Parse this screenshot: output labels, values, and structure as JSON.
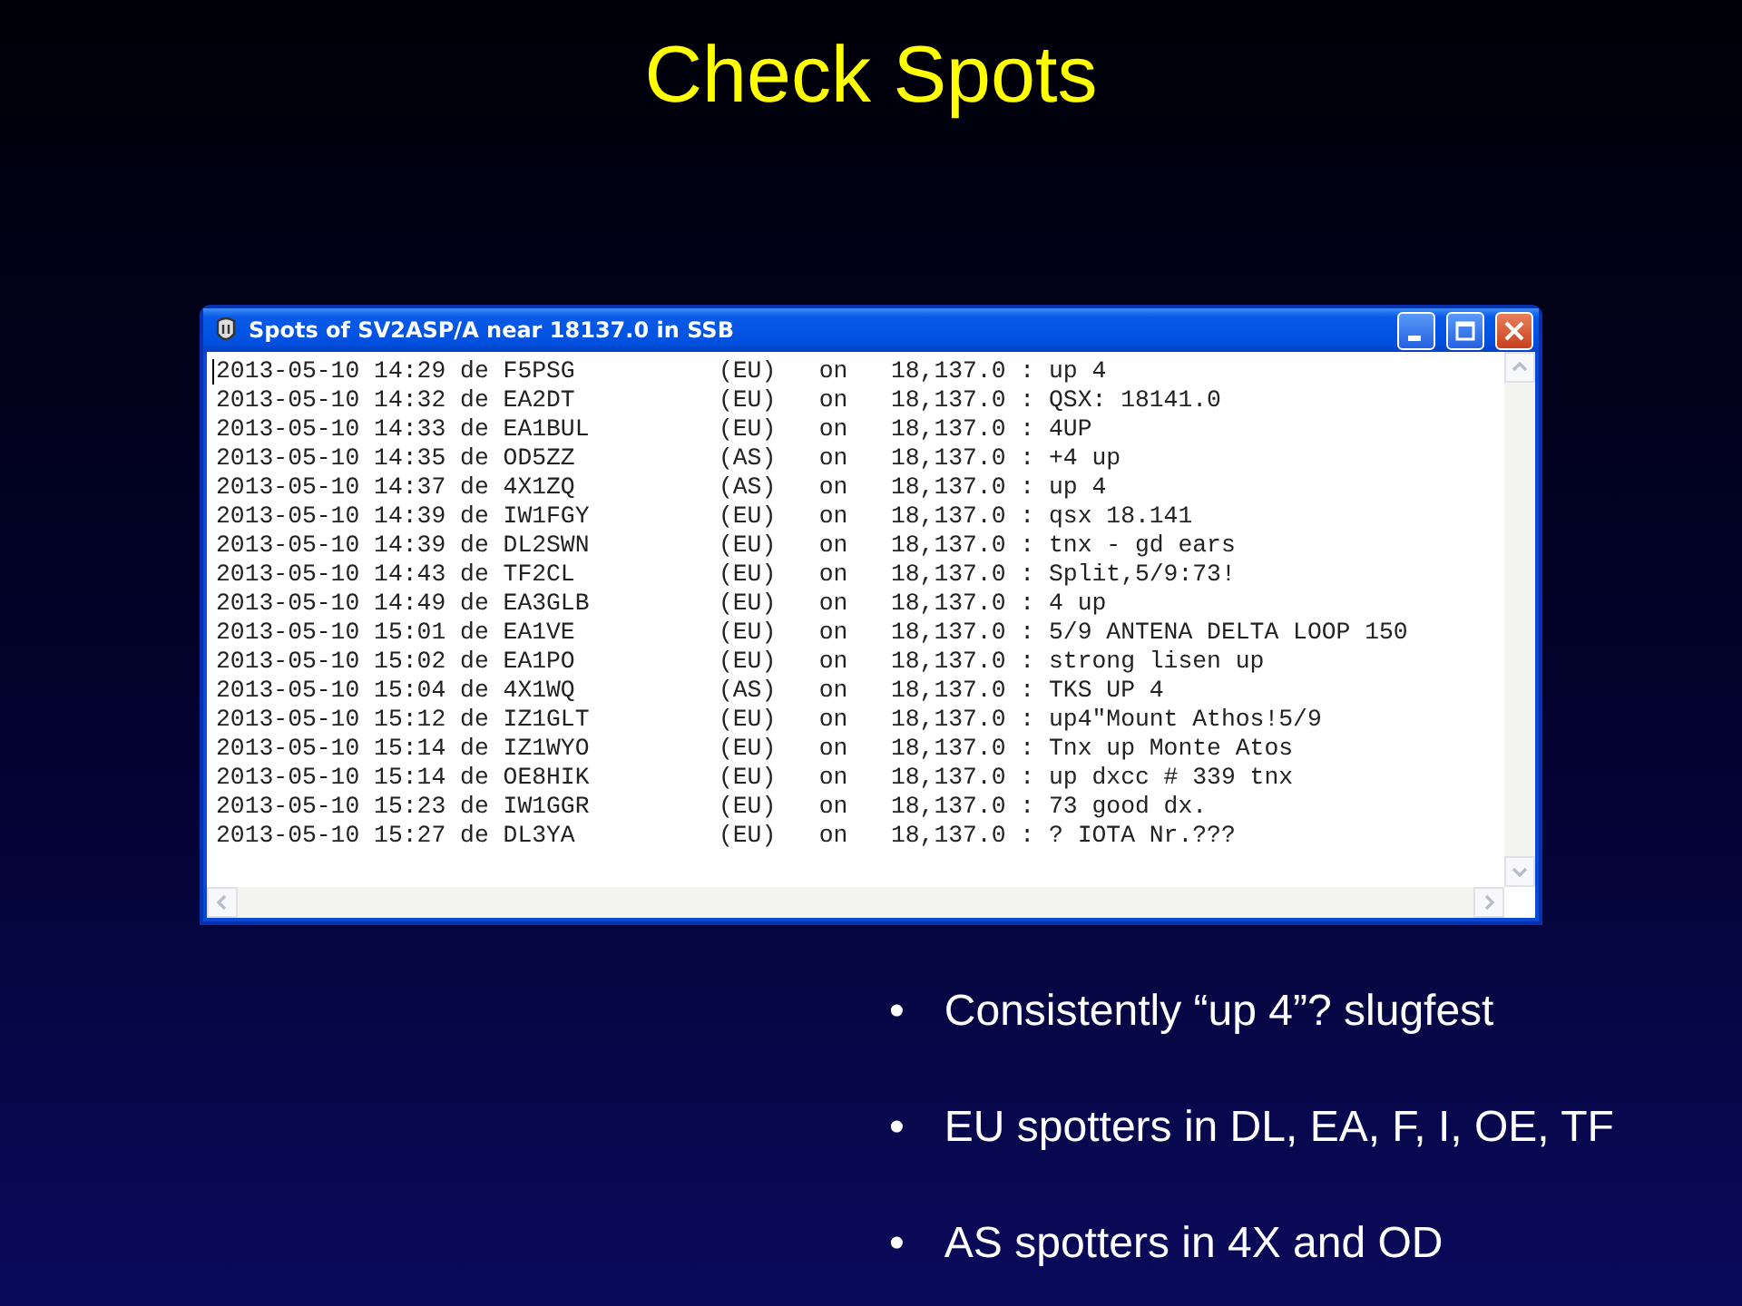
{
  "slide": {
    "title": "Check Spots"
  },
  "window": {
    "title": "Spots of SV2ASP/A near 18137.0 in SSB",
    "lines": [
      "2013-05-10 14:29 de F5PSG          (EU)   on   18,137.0 : up 4",
      "2013-05-10 14:32 de EA2DT          (EU)   on   18,137.0 : QSX: 18141.0",
      "2013-05-10 14:33 de EA1BUL         (EU)   on   18,137.0 : 4UP",
      "2013-05-10 14:35 de OD5ZZ          (AS)   on   18,137.0 : +4 up",
      "2013-05-10 14:37 de 4X1ZQ          (AS)   on   18,137.0 : up 4",
      "2013-05-10 14:39 de IW1FGY         (EU)   on   18,137.0 : qsx 18.141",
      "2013-05-10 14:39 de DL2SWN         (EU)   on   18,137.0 : tnx - gd ears",
      "2013-05-10 14:43 de TF2CL          (EU)   on   18,137.0 : Split,5/9:73!",
      "2013-05-10 14:49 de EA3GLB         (EU)   on   18,137.0 : 4 up",
      "2013-05-10 15:01 de EA1VE          (EU)   on   18,137.0 : 5/9 ANTENA DELTA LOOP 150",
      "2013-05-10 15:02 de EA1PO          (EU)   on   18,137.0 : strong lisen up",
      "2013-05-10 15:04 de 4X1WQ          (AS)   on   18,137.0 : TKS UP 4",
      "2013-05-10 15:12 de IZ1GLT         (EU)   on   18,137.0 : up4\"Mount Athos!5/9",
      "2013-05-10 15:14 de IZ1WYO         (EU)   on   18,137.0 : Tnx up Monte Atos",
      "2013-05-10 15:14 de OE8HIK         (EU)   on   18,137.0 : up dxcc # 339 tnx",
      "2013-05-10 15:23 de IW1GGR         (EU)   on   18,137.0 : 73 good dx.",
      "2013-05-10 15:27 de DL3YA          (EU)   on   18,137.0 : ? IOTA Nr.???"
    ]
  },
  "bullets": [
    {
      "marker": "•",
      "text": "Consistently “up 4”? slugfest"
    },
    {
      "marker": "•",
      "text": "EU spotters in DL, EA, F, I, OE, TF"
    },
    {
      "marker": "•",
      "text": "AS spotters in 4X and OD"
    }
  ]
}
